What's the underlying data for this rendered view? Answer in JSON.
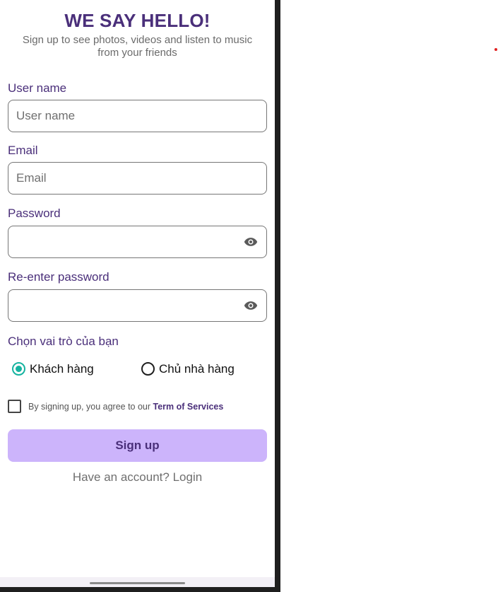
{
  "header": {
    "title": "WE SAY HELLO!",
    "subtitle": "Sign up to see photos, videos and listen to music from your friends"
  },
  "form": {
    "username": {
      "label": "User name",
      "placeholder": "User name",
      "value": ""
    },
    "email": {
      "label": "Email",
      "placeholder": "Email",
      "value": ""
    },
    "password": {
      "label": "Password",
      "value": "",
      "toggle_icon": "eye-icon"
    },
    "reenter_password": {
      "label": "Re-enter password",
      "value": "",
      "toggle_icon": "eye-icon"
    },
    "role": {
      "label": "Chọn vai trò của bạn",
      "options": [
        {
          "label": "Khách hàng",
          "selected": true
        },
        {
          "label": "Chủ nhà hàng",
          "selected": false
        }
      ]
    },
    "terms": {
      "checked": false,
      "text": "By signing up, you agree to our ",
      "link": "Term of Services"
    },
    "submit_label": "Sign up"
  },
  "footer": {
    "prompt": "Have an account? ",
    "login_link": "Login"
  },
  "colors": {
    "accent": "#4a2f7a",
    "button_bg": "#ccb4fb",
    "radio_selected": "#16b3a0"
  }
}
